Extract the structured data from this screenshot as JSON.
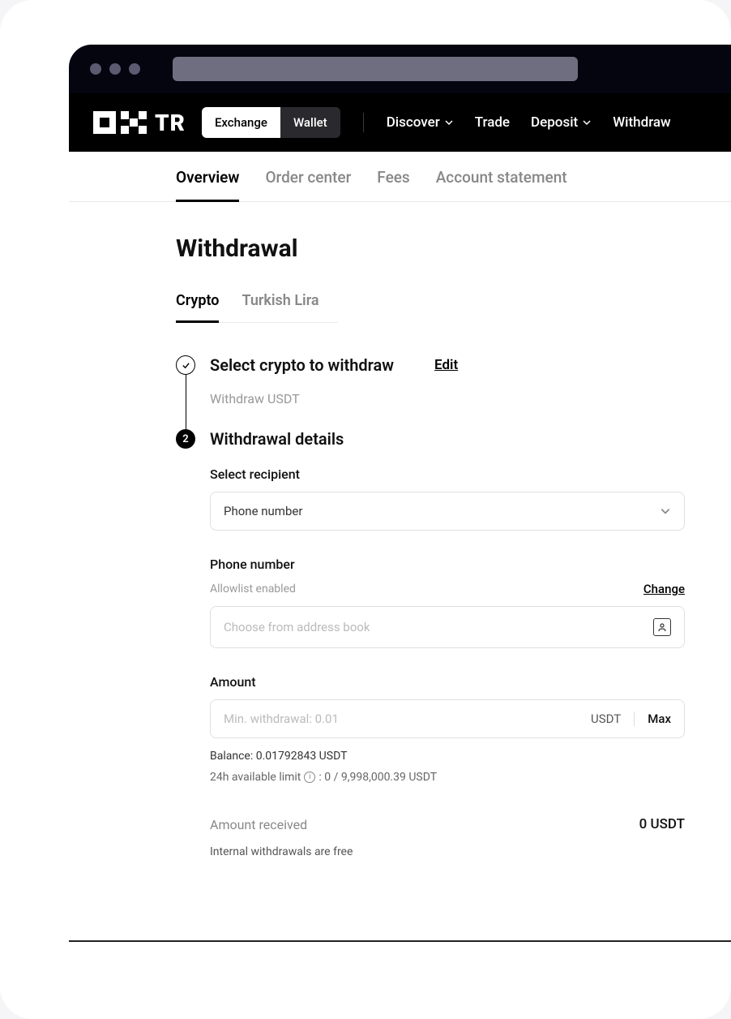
{
  "header": {
    "logo_text": "TR",
    "mode_toggle": {
      "exchange": "Exchange",
      "wallet": "Wallet"
    },
    "nav": {
      "discover": "Discover",
      "trade": "Trade",
      "deposit": "Deposit",
      "withdraw": "Withdraw"
    }
  },
  "subnav": {
    "overview": "Overview",
    "order_center": "Order center",
    "fees": "Fees",
    "account_statement": "Account statement"
  },
  "page": {
    "title": "Withdrawal",
    "tabs": {
      "crypto": "Crypto",
      "turkish_lira": "Turkish Lira"
    }
  },
  "step1": {
    "title": "Select crypto to withdraw",
    "edit": "Edit",
    "subtext": "Withdraw USDT"
  },
  "step2": {
    "number": "2",
    "title": "Withdrawal details",
    "recipient": {
      "label": "Select recipient",
      "value": "Phone number"
    },
    "phone": {
      "label": "Phone number",
      "sublabel": "Allowlist enabled",
      "change": "Change",
      "placeholder": "Choose from address book"
    },
    "amount": {
      "label": "Amount",
      "placeholder": "Min. withdrawal: 0.01",
      "unit": "USDT",
      "max": "Max",
      "balance": "Balance: 0.01792843 USDT",
      "limit_prefix": "24h available limit",
      "limit_value": ": 0 / 9,998,000.39 USDT"
    },
    "received": {
      "label": "Amount received",
      "value": "0 USDT"
    },
    "fee_note": "Internal withdrawals are free"
  }
}
